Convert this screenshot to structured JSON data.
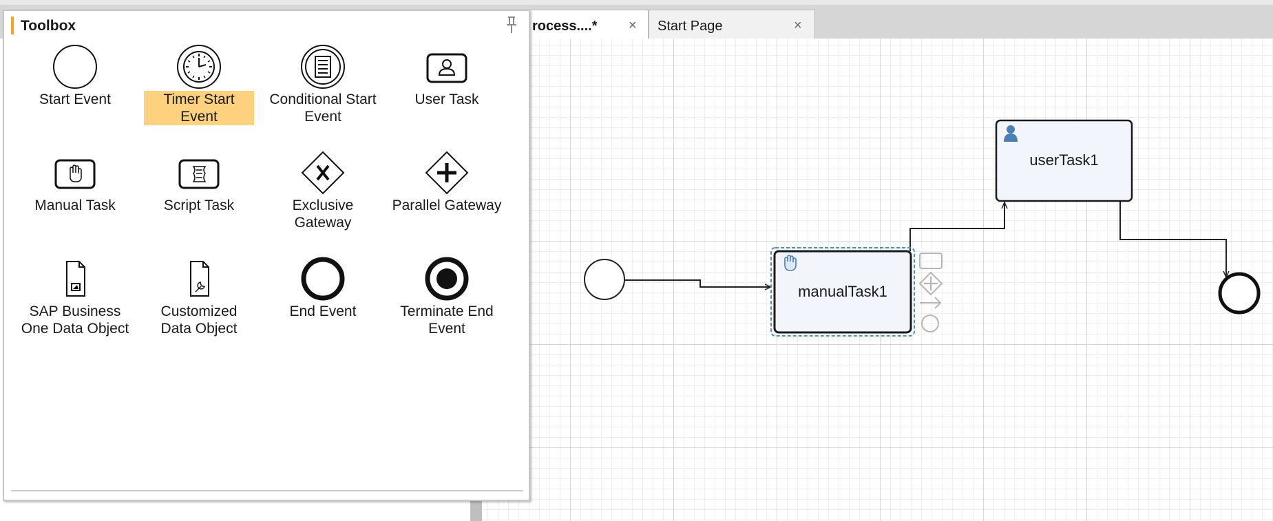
{
  "tabs": [
    {
      "label": "rocess....*",
      "close": "×",
      "active": true
    },
    {
      "label": "Start Page",
      "close": "×",
      "active": false
    }
  ],
  "toolbox": {
    "title": "Toolbox",
    "selected": "Timer Start Event",
    "items": [
      {
        "label": "Start Event",
        "icon": "start-event-icon"
      },
      {
        "label": "Timer Start Event",
        "icon": "timer-start-event-icon"
      },
      {
        "label": "Conditional Start Event",
        "icon": "conditional-start-event-icon"
      },
      {
        "label": "User Task",
        "icon": "user-task-icon"
      },
      {
        "label": "Manual Task",
        "icon": "manual-task-icon"
      },
      {
        "label": "Script Task",
        "icon": "script-task-icon"
      },
      {
        "label": "Exclusive Gateway",
        "icon": "exclusive-gateway-icon"
      },
      {
        "label": "Parallel Gateway",
        "icon": "parallel-gateway-icon"
      },
      {
        "label": "SAP Business One Data Object",
        "icon": "data-object-icon"
      },
      {
        "label": "Customized Data Object",
        "icon": "customized-data-object-icon"
      },
      {
        "label": "End Event",
        "icon": "end-event-icon"
      },
      {
        "label": "Terminate End Event",
        "icon": "terminate-end-event-icon"
      }
    ]
  },
  "diagram": {
    "manual_task": {
      "label": "manualTask1",
      "icon": "hand-icon",
      "selected": true
    },
    "user_task": {
      "label": "userTask1",
      "icon": "user-icon"
    },
    "quick_actions": [
      "task-shape-icon",
      "gateway-shape-icon",
      "sequence-flow-icon",
      "event-shape-icon"
    ]
  },
  "colors": {
    "selection": "#fdd17d",
    "accent": "#f5a623",
    "task_fill": "#f3f5fc",
    "selection_outline": "#4a90d9",
    "user_icon": "#4a7fb8"
  }
}
